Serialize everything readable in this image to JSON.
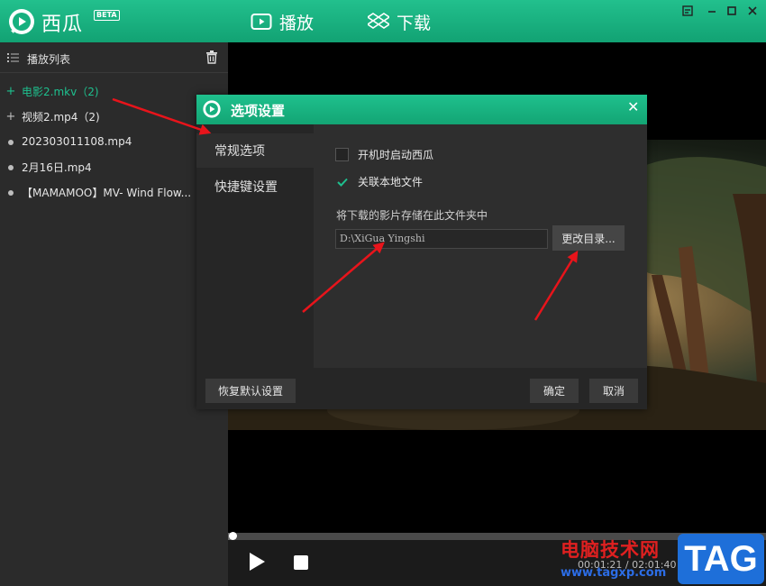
{
  "app": {
    "name": "西瓜",
    "badge": "BETA",
    "nav": [
      {
        "label": "播放",
        "icon": "play-rect-icon"
      },
      {
        "label": "下载",
        "icon": "dropbox-icon"
      }
    ],
    "window_controls": [
      "menu-icon",
      "minimize-icon",
      "maximize-icon",
      "close-icon"
    ]
  },
  "sidebar": {
    "title": "播放列表",
    "items": [
      {
        "label": "电影2.mkv（2)",
        "active": true,
        "marker": "+"
      },
      {
        "label": "视频2.mp4（2)",
        "active": false,
        "marker": "+"
      },
      {
        "label": "202303011108.mp4",
        "active": false,
        "marker": "dot"
      },
      {
        "label": "2月16日.mp4",
        "active": false,
        "marker": "dot"
      },
      {
        "label": "【MAMAMOO】MV- Wind Flow...",
        "active": false,
        "marker": "dot"
      }
    ]
  },
  "player": {
    "time": "00:01:21 / 02:01:40",
    "progress_fraction": 0.01
  },
  "dialog": {
    "title": "选项设置",
    "close": "✕",
    "nav": [
      {
        "label": "常规选项",
        "active": true
      },
      {
        "label": "快捷键设置",
        "active": false
      }
    ],
    "options": [
      {
        "label": "开机时启动西瓜",
        "checked": false
      },
      {
        "label": "关联本地文件",
        "checked": true
      }
    ],
    "dir_label": "将下载的影片存储在此文件夹中",
    "dir_value": "D:\\XiGua Yingshi",
    "change_button": "更改目录...",
    "reset_button": "恢复默认设置",
    "ok_button": "确定",
    "cancel_button": "取消"
  },
  "watermark": {
    "site_name": "电脑技术网",
    "url": "www.tagxp.com",
    "tag": "TAG"
  },
  "colors": {
    "accent": "#1ec08e",
    "annotation": "#e8141b"
  }
}
